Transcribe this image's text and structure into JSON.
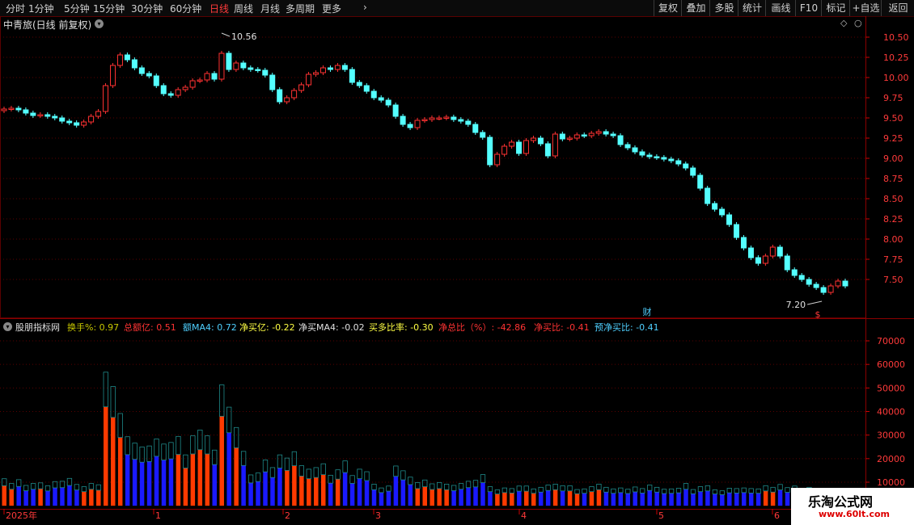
{
  "toolbar": {
    "periods": [
      "分时",
      "1分钟",
      "5分钟",
      "15分钟",
      "30分钟",
      "60分钟",
      "日线",
      "周线",
      "月线",
      "多周期",
      "更多"
    ],
    "active": "日线",
    "buttons": [
      "复权",
      "叠加",
      "多股",
      "统计",
      "画线",
      "F10",
      "标记",
      "+自选",
      "返回"
    ]
  },
  "stock": {
    "title": "中青旅(日线 前复权)"
  },
  "price_axis": {
    "labels": [
      "10.50",
      "10.25",
      "10.00",
      "9.75",
      "9.50",
      "9.25",
      "9.00",
      "8.75",
      "8.50",
      "8.25",
      "8.00",
      "7.75",
      "7.50"
    ]
  },
  "annotations": {
    "high_label": "10.56",
    "low_label": "7.20",
    "finance_marker": "财",
    "signal_marker": "$"
  },
  "indicator": {
    "name": "股朋指标网",
    "items": [
      {
        "label": "换手%",
        "value": "0.97",
        "color": "#c8c800"
      },
      {
        "label": "总额亿",
        "value": "0.51",
        "color": "#ff3333"
      },
      {
        "label": "额MA4",
        "value": "0.72",
        "color": "#4fd0ff"
      },
      {
        "label": "净买亿",
        "value": "-0.22",
        "color": "#ffff44"
      },
      {
        "label": "净买MA4",
        "value": "-0.02",
        "color": "#e0e0e0"
      },
      {
        "label": "买多比率",
        "value": "-0.30",
        "color": "#ffff44"
      },
      {
        "label": "净总比（%）",
        "value": "-42.86",
        "color": "#ff3333"
      },
      {
        "label": "净买比",
        "value": "-0.41",
        "color": "#ff3333"
      },
      {
        "label": "预净买比",
        "value": "-0.41",
        "color": "#4fd0ff"
      }
    ]
  },
  "volume_axis": {
    "labels": [
      "70000",
      "60000",
      "50000",
      "40000",
      "30000",
      "20000",
      "10000"
    ]
  },
  "date_axis": {
    "labels": [
      "2025年",
      "1",
      "2",
      "3",
      "4",
      "5",
      "6"
    ]
  },
  "logo": {
    "main": "乐淘公式网",
    "sub": "www.60lt.com"
  },
  "colors": {
    "up": "#ff3232",
    "down": "#54ffff",
    "blue_bar": "#1a1aff",
    "red_bar": "#ff3a00",
    "grid": "#5a0000"
  },
  "chart_data": {
    "type": "candlestick",
    "ylim": [
      7.2,
      10.56
    ],
    "closes": [
      9.61,
      9.62,
      9.6,
      9.56,
      9.53,
      9.54,
      9.52,
      9.5,
      9.46,
      9.44,
      9.41,
      9.45,
      9.52,
      9.58,
      9.9,
      10.15,
      10.28,
      10.22,
      10.12,
      10.05,
      10.02,
      9.9,
      9.8,
      9.78,
      9.85,
      9.88,
      9.96,
      9.97,
      10.05,
      9.98,
      10.3,
      10.1,
      10.18,
      10.12,
      10.1,
      10.09,
      10.03,
      9.85,
      9.7,
      9.75,
      9.84,
      9.91,
      10.04,
      10.06,
      10.12,
      10.1,
      10.15,
      10.1,
      9.94,
      9.9,
      9.83,
      9.75,
      9.72,
      9.66,
      9.52,
      9.42,
      9.38,
      9.47,
      9.48,
      9.5,
      9.5,
      9.51,
      9.48,
      9.46,
      9.42,
      9.32,
      9.26,
      8.92,
      9.05,
      9.15,
      9.2,
      9.06,
      9.22,
      9.25,
      9.18,
      9.03,
      9.3,
      9.24,
      9.25,
      9.29,
      9.28,
      9.31,
      9.33,
      9.3,
      9.28,
      9.17,
      9.13,
      9.08,
      9.04,
      9.02,
      9.01,
      8.99,
      8.97,
      8.93,
      8.88,
      8.79,
      8.63,
      8.44,
      8.37,
      8.3,
      8.18,
      8.02,
      7.89,
      7.77,
      7.7,
      7.79,
      7.9,
      7.79,
      7.62,
      7.55,
      7.5,
      7.44,
      7.4,
      7.34,
      7.42,
      7.48,
      7.42
    ],
    "volumes": [
      8500,
      7000,
      8200,
      6400,
      7000,
      7200,
      6300,
      7600,
      7700,
      8600,
      6700,
      6000,
      7000,
      6600,
      42000,
      37500,
      29000,
      21700,
      19700,
      18500,
      18800,
      21000,
      19400,
      19900,
      21800,
      16000,
      22000,
      23800,
      22000,
      17500,
      38000,
      31000,
      24600,
      17100,
      9700,
      10300,
      14400,
      12000,
      16000,
      15000,
      17000,
      12600,
      11500,
      12000,
      13200,
      9600,
      11300,
      14100,
      9500,
      11500,
      10700,
      6800,
      5600,
      6200,
      12500,
      11000,
      9000,
      7300,
      8100,
      6900,
      7300,
      6800,
      6400,
      7000,
      7700,
      8000,
      9800,
      6000,
      5000,
      5600,
      5400,
      6200,
      6200,
      5300,
      5800,
      6500,
      6800,
      6300,
      6300,
      5100,
      5300,
      6000,
      6800,
      5800,
      5300,
      5600,
      5200,
      5900,
      5400,
      6500,
      5800,
      5200,
      5300,
      5500,
      7000,
      5100,
      6000,
      6300,
      5000,
      4700,
      5500,
      5400,
      5600,
      5400,
      5300,
      6300,
      5800,
      6700,
      5700,
      6200,
      5100,
      5800,
      4600,
      5200,
      5400,
      4800,
      5500
    ]
  }
}
